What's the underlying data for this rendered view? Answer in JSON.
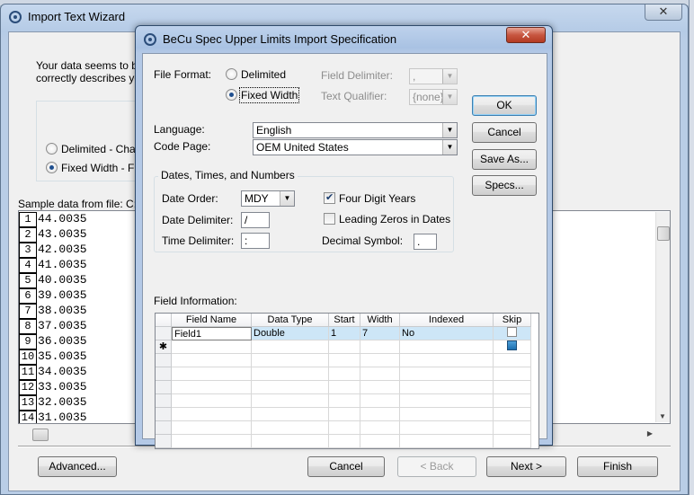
{
  "wizard": {
    "title": "Import Text Wizard",
    "close_glyph": "✕",
    "intro_line1": "Your data seems to be i",
    "intro_line2": "correctly describes you",
    "radio_delimited": "Delimited - Characte",
    "radio_fixed": "Fixed Width - Field",
    "sample_label": "Sample data from file: C:\\U",
    "sample_rows": [
      {
        "n": "1",
        "v": "44.0035"
      },
      {
        "n": "2",
        "v": "43.0035"
      },
      {
        "n": "3",
        "v": "42.0035"
      },
      {
        "n": "4",
        "v": "41.0035"
      },
      {
        "n": "5",
        "v": "40.0035"
      },
      {
        "n": "6",
        "v": "39.0035"
      },
      {
        "n": "7",
        "v": "38.0035"
      },
      {
        "n": "8",
        "v": "37.0035"
      },
      {
        "n": "9",
        "v": "36.0035"
      },
      {
        "n": "10",
        "v": "35.0035"
      },
      {
        "n": "11",
        "v": "34.0035"
      },
      {
        "n": "12",
        "v": "33.0035"
      },
      {
        "n": "13",
        "v": "32.0035"
      },
      {
        "n": "14",
        "v": "31.0035"
      }
    ],
    "advanced_btn": "Advanced...",
    "cancel_btn": "Cancel",
    "back_btn": "< Back",
    "next_btn": "Next >",
    "finish_btn": "Finish"
  },
  "spec": {
    "title": "BeCu Spec Upper Limits Import Specification",
    "close_glyph": "✕",
    "file_format_label": "File Format:",
    "opt_delimited": "Delimited",
    "opt_fixed": "Fixed Width",
    "field_delimiter_label": "Field Delimiter:",
    "field_delimiter_value": ",",
    "text_qualifier_label": "Text Qualifier:",
    "text_qualifier_value": "{none}",
    "language_label": "Language:",
    "language_value": "English",
    "code_page_label": "Code Page:",
    "code_page_value": "OEM United States",
    "dates_group": "Dates, Times, and Numbers",
    "date_order_label": "Date Order:",
    "date_order_value": "MDY",
    "date_delim_label": "Date Delimiter:",
    "date_delim_value": "/",
    "time_delim_label": "Time Delimiter:",
    "time_delim_value": ":",
    "four_digit_years": "Four Digit Years",
    "leading_zeros": "Leading Zeros in Dates",
    "decimal_symbol_label": "Decimal Symbol:",
    "decimal_symbol_value": ".",
    "field_info_label": "Field Information:",
    "columns": [
      "Field Name",
      "Data Type",
      "Start",
      "Width",
      "Indexed",
      "Skip"
    ],
    "row": {
      "name": "Field1",
      "type": "Double",
      "start": "1",
      "width": "7",
      "indexed": "No"
    },
    "new_row_marker": "✱",
    "ok_btn": "OK",
    "cancel_btn": "Cancel",
    "save_as_btn": "Save As...",
    "specs_btn": "Specs..."
  }
}
